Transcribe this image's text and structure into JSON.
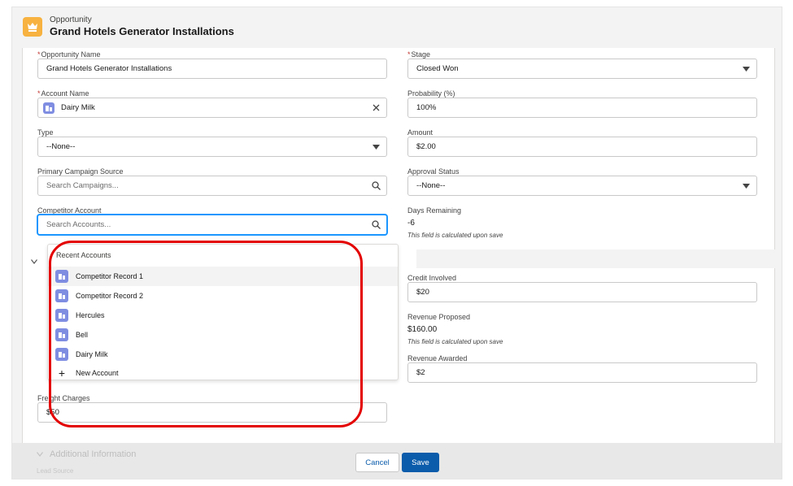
{
  "header": {
    "object_label": "Opportunity",
    "record_title": "Grand Hotels Generator Installations"
  },
  "left": {
    "opportunity_name": {
      "label": "Opportunity Name",
      "value": "Grand Hotels Generator Installations"
    },
    "account_name": {
      "label": "Account Name",
      "value": "Dairy Milk"
    },
    "type": {
      "label": "Type",
      "value": "--None--"
    },
    "primary_campaign_source": {
      "label": "Primary Campaign Source",
      "placeholder": "Search Campaigns..."
    },
    "competitor_account": {
      "label": "Competitor Account",
      "placeholder": "Search Accounts..."
    },
    "freight_charges": {
      "label": "Freight Charges",
      "value": "$50"
    }
  },
  "right": {
    "stage": {
      "label": "Stage",
      "value": "Closed Won"
    },
    "probability": {
      "label": "Probability (%)",
      "value": "100%"
    },
    "amount": {
      "label": "Amount",
      "value": "$2.00"
    },
    "approval_status": {
      "label": "Approval Status",
      "value": "--None--"
    },
    "days_remaining": {
      "label": "Days Remaining",
      "value": "-6",
      "help": "This field is calculated upon save"
    },
    "credit_involved": {
      "label": "Credit Involved",
      "value": "$20"
    },
    "revenue_proposed": {
      "label": "Revenue Proposed",
      "value": "$160.00",
      "help": "This field is calculated upon save"
    },
    "revenue_awarded": {
      "label": "Revenue Awarded",
      "value": "$2"
    }
  },
  "dropdown": {
    "heading": "Recent Accounts",
    "items": [
      {
        "label": "Competitor Record 1"
      },
      {
        "label": "Competitor Record 2"
      },
      {
        "label": "Hercules"
      },
      {
        "label": "Bell"
      },
      {
        "label": "Dairy Milk"
      }
    ],
    "new_label": "New Account"
  },
  "footer": {
    "section_title": "Additional Information",
    "next_label": "Lead Source",
    "cancel_label": "Cancel",
    "save_label": "Save"
  },
  "colors": {
    "brand": "#0b5cab",
    "object_icon": "#f7b240",
    "account_icon": "#7f8de1",
    "required": "#c23934",
    "annotation_ring": "#e40000"
  },
  "icons": {
    "object": "crown-icon",
    "account": "account-icon",
    "search": "search-icon",
    "clear": "close-icon",
    "picklist": "caret-down-icon",
    "new": "plus-icon"
  }
}
